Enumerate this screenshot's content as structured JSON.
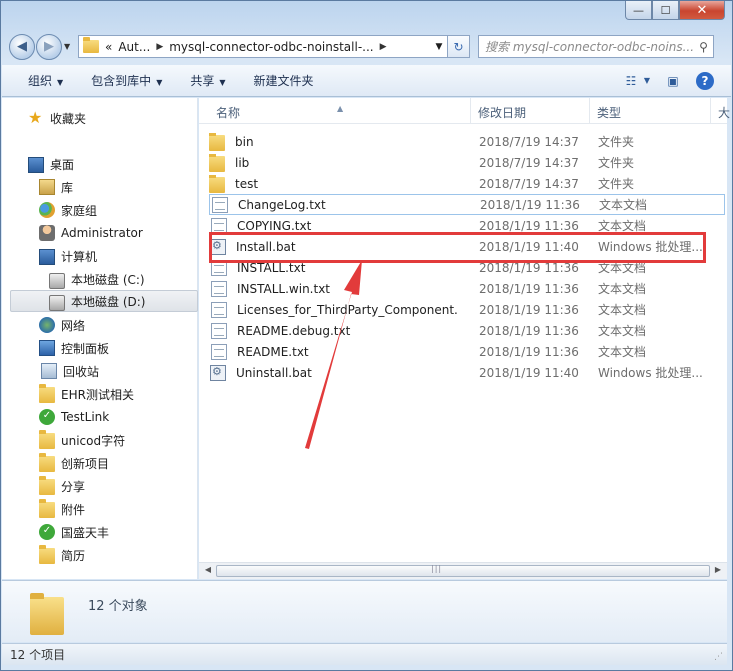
{
  "titlebar": {
    "min": "—",
    "max": "☐",
    "close": "✕"
  },
  "nav": {
    "back_icon": "◀",
    "fwd_icon": "▶",
    "address_segments": [
      "«",
      "Aut...",
      "mysql-connector-odbc-noinstall-..."
    ],
    "refresh_icon": "↻",
    "search_placeholder": "搜索 mysql-connector-odbc-noins...",
    "search_icon": "🔍"
  },
  "toolbar": {
    "organize": "组织",
    "include_library": "包含到库中",
    "share": "共享",
    "new_folder": "新建文件夹",
    "help": "?"
  },
  "sidebar": {
    "items": [
      {
        "label": "收藏夹",
        "icon": "star-icon"
      },
      {
        "label": "桌面",
        "icon": "desktop-icon"
      },
      {
        "label": "库",
        "icon": "library-icon"
      },
      {
        "label": "家庭组",
        "icon": "homegroup-icon"
      },
      {
        "label": "Administrator",
        "icon": "user-folder-icon"
      },
      {
        "label": "计算机",
        "icon": "computer-icon"
      },
      {
        "label": "本地磁盘 (C:)",
        "icon": "drive-icon"
      },
      {
        "label": "本地磁盘 (D:)",
        "icon": "drive-icon"
      },
      {
        "label": "网络",
        "icon": "network-icon"
      },
      {
        "label": "控制面板",
        "icon": "control-panel-icon"
      },
      {
        "label": "回收站",
        "icon": "recycle-bin-icon"
      },
      {
        "label": "EHR测试相关",
        "icon": "folder-icon"
      },
      {
        "label": "TestLink",
        "icon": "sync-folder-icon"
      },
      {
        "label": "unicod字符",
        "icon": "folder-icon"
      },
      {
        "label": "创新项目",
        "icon": "folder-icon"
      },
      {
        "label": "分享",
        "icon": "folder-icon"
      },
      {
        "label": "附件",
        "icon": "folder-icon"
      },
      {
        "label": "国盛天丰",
        "icon": "sync-folder-icon"
      },
      {
        "label": "简历",
        "icon": "folder-icon"
      }
    ]
  },
  "columns": {
    "name": "名称",
    "date": "修改日期",
    "type": "类型",
    "extra": "大"
  },
  "files": [
    {
      "name": "bin",
      "date": "2018/7/19 14:37",
      "type": "文件夹",
      "kind": "folder"
    },
    {
      "name": "lib",
      "date": "2018/7/19 14:37",
      "type": "文件夹",
      "kind": "folder"
    },
    {
      "name": "test",
      "date": "2018/7/19 14:37",
      "type": "文件夹",
      "kind": "folder"
    },
    {
      "name": "ChangeLog.txt",
      "date": "2018/1/19 11:36",
      "type": "文本文档",
      "kind": "txt"
    },
    {
      "name": "COPYING.txt",
      "date": "2018/1/19 11:36",
      "type": "文本文档",
      "kind": "txt"
    },
    {
      "name": "Install.bat",
      "date": "2018/1/19 11:40",
      "type": "Windows 批处理...",
      "kind": "bat"
    },
    {
      "name": "INSTALL.txt",
      "date": "2018/1/19 11:36",
      "type": "文本文档",
      "kind": "txt"
    },
    {
      "name": "INSTALL.win.txt",
      "date": "2018/1/19 11:36",
      "type": "文本文档",
      "kind": "txt"
    },
    {
      "name": "Licenses_for_ThirdParty_Component...",
      "date": "2018/1/19 11:36",
      "type": "文本文档",
      "kind": "txt"
    },
    {
      "name": "README.debug.txt",
      "date": "2018/1/19 11:36",
      "type": "文本文档",
      "kind": "txt"
    },
    {
      "name": "README.txt",
      "date": "2018/1/19 11:36",
      "type": "文本文档",
      "kind": "txt"
    },
    {
      "name": "Uninstall.bat",
      "date": "2018/1/19 11:40",
      "type": "Windows 批处理...",
      "kind": "bat"
    }
  ],
  "details": {
    "count": "12 个对象"
  },
  "status": {
    "items": "12 个项目"
  },
  "colors": {
    "annotation": "#e23b3b"
  }
}
